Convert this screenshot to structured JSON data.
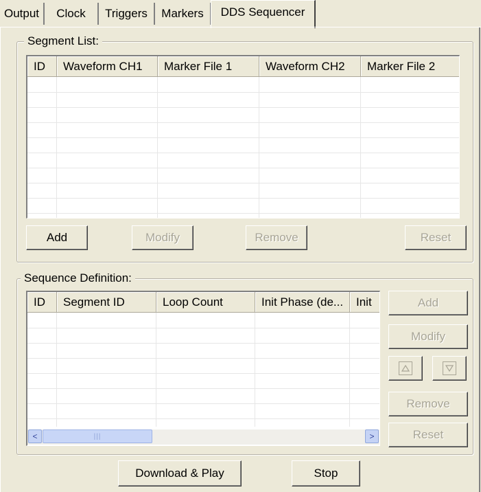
{
  "tabs": [
    {
      "label": "Output",
      "active": false
    },
    {
      "label": "Clock",
      "active": false
    },
    {
      "label": "Triggers",
      "active": false
    },
    {
      "label": "Markers",
      "active": false
    },
    {
      "label": "DDS Sequencer",
      "active": true
    }
  ],
  "segment_list": {
    "title": "Segment List:",
    "columns": [
      "ID",
      "Waveform CH1",
      "Marker File 1",
      "Waveform CH2",
      "Marker File 2"
    ],
    "rows": [],
    "buttons": {
      "add": "Add",
      "modify": "Modify",
      "remove": "Remove",
      "reset": "Reset"
    }
  },
  "sequence_definition": {
    "title": "Sequence Definition:",
    "columns": [
      "ID",
      "Segment ID",
      "Loop Count",
      "Init Phase (de...",
      "Init"
    ],
    "rows": [],
    "buttons": {
      "add": "Add",
      "modify": "Modify",
      "remove": "Remove",
      "reset": "Reset"
    },
    "scrollbar": {
      "left_arrow": "<",
      "right_arrow": ">",
      "grip": "|||"
    }
  },
  "footer": {
    "download_play": "Download & Play",
    "stop": "Stop"
  },
  "icons": {
    "move_up": "triangle-up-icon",
    "move_down": "triangle-down-icon"
  },
  "colors": {
    "face": "#ece9d8",
    "disabled_text": "#a8a596",
    "scroll_blue": "#c5d3f5"
  }
}
